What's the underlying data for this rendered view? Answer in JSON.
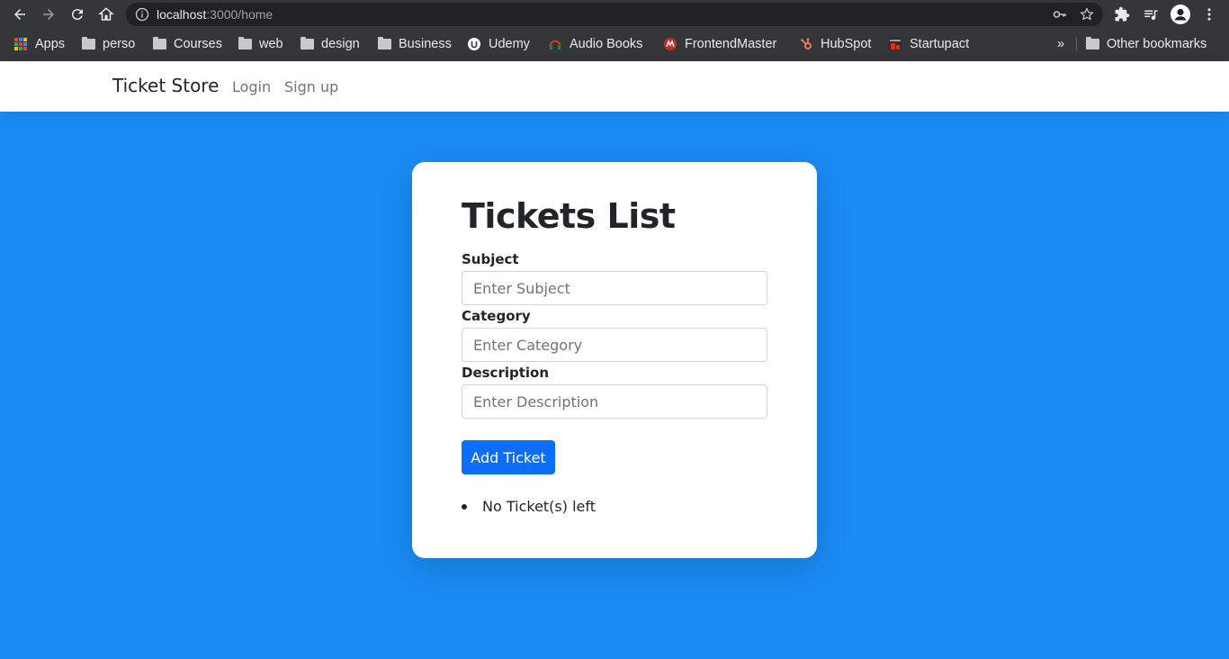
{
  "browser": {
    "url_host": "localhost",
    "url_path": ":3000/home",
    "bookmarks": [
      {
        "label": "Apps",
        "icon": "apps-grid-icon"
      },
      {
        "label": "perso",
        "icon": "folder-icon"
      },
      {
        "label": "Courses",
        "icon": "folder-icon"
      },
      {
        "label": "web",
        "icon": "folder-icon"
      },
      {
        "label": "design",
        "icon": "folder-icon"
      },
      {
        "label": "Business",
        "icon": "folder-icon"
      },
      {
        "label": "Udemy",
        "icon": "udemy-icon"
      },
      {
        "label": "Audio Books",
        "icon": "audio-books-icon"
      },
      {
        "label": "FrontendMaster",
        "icon": "frontendmaster-icon"
      },
      {
        "label": "HubSpot",
        "icon": "hubspot-icon"
      },
      {
        "label": "Startupact",
        "icon": "startupact-icon"
      }
    ],
    "overflow_label": "»",
    "other_bookmarks": "Other bookmarks"
  },
  "navbar": {
    "brand": "Ticket Store",
    "links": [
      "Login",
      "Sign up"
    ]
  },
  "card": {
    "title": "Tickets List",
    "fields": [
      {
        "label": "Subject",
        "placeholder": "Enter Subject",
        "value": ""
      },
      {
        "label": "Category",
        "placeholder": "Enter Category",
        "value": ""
      },
      {
        "label": "Description",
        "placeholder": "Enter Description",
        "value": ""
      }
    ],
    "add_button": "Add Ticket",
    "tickets": [
      "No Ticket(s) left"
    ]
  },
  "colors": {
    "page_background": "#1a8cf5",
    "primary_button": "#0d6efd",
    "browser_chrome": "#35363a"
  }
}
